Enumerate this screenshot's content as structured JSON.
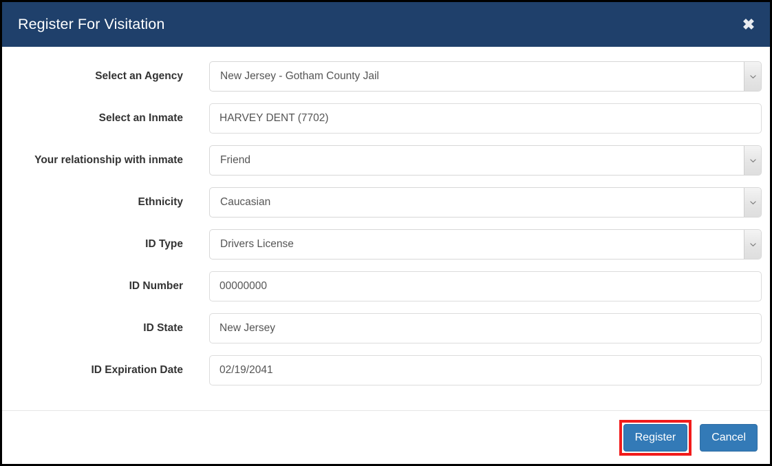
{
  "modal": {
    "title": "Register For Visitation",
    "close_icon": "close-icon",
    "close_glyph": "✖",
    "header_color": "#1f406b"
  },
  "form": {
    "fields": [
      {
        "label": "Select an Agency",
        "type": "select",
        "value": "New Jersey - Gotham County Jail",
        "name": "agency"
      },
      {
        "label": "Select an Inmate",
        "type": "text",
        "value": "HARVEY DENT (7702)",
        "name": "inmate"
      },
      {
        "label": "Your relationship with inmate",
        "type": "select",
        "value": "Friend",
        "name": "relationship"
      },
      {
        "label": "Ethnicity",
        "type": "select",
        "value": "Caucasian",
        "name": "ethnicity"
      },
      {
        "label": "ID Type",
        "type": "select",
        "value": "Drivers License",
        "name": "id-type"
      },
      {
        "label": "ID Number",
        "type": "text",
        "value": "00000000",
        "name": "id-number"
      },
      {
        "label": "ID State",
        "type": "text",
        "value": "New Jersey",
        "name": "id-state"
      },
      {
        "label": "ID Expiration Date",
        "type": "text",
        "value": "02/19/2041",
        "name": "id-expiration-date"
      }
    ]
  },
  "footer": {
    "register_label": "Register",
    "cancel_label": "Cancel",
    "primary_color": "#337ab7",
    "highlight_color": "#f21b1b"
  }
}
